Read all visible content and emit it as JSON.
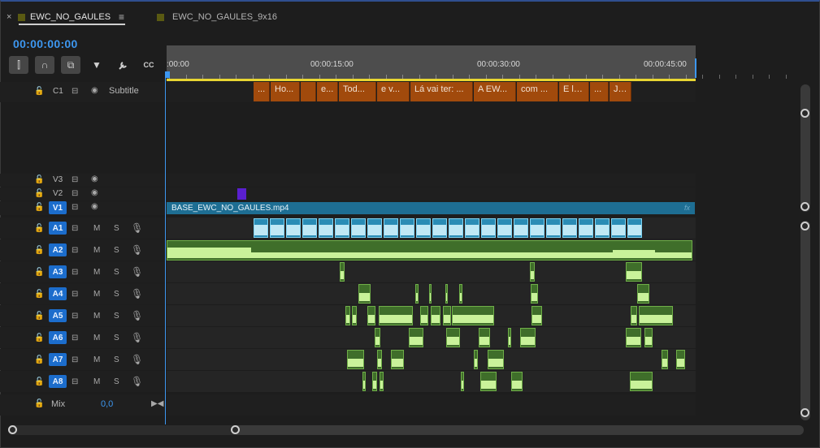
{
  "tabs": [
    {
      "label": "EWC_NO_GAULES",
      "active": true
    },
    {
      "label": "EWC_NO_GAULES_9x16",
      "active": false
    }
  ],
  "close_glyph": "×",
  "menu_glyph": "≡",
  "timecode": "00:00:00:00",
  "tools": [
    {
      "name": "insert-overwrite-icon",
      "glyph": "⫿",
      "on": true
    },
    {
      "name": "snap-magnet-icon",
      "glyph": "∩",
      "on": true
    },
    {
      "name": "linked-selection-icon",
      "glyph": "⧉",
      "on": true
    },
    {
      "name": "add-marker-icon",
      "glyph": "▼",
      "on": false
    },
    {
      "name": "wrench-icon",
      "glyph": "🔧",
      "on": false
    },
    {
      "name": "captions-icon",
      "glyph": "CC",
      "on": false
    }
  ],
  "ruler": {
    "labels": [
      ":00:00",
      "00:00:15:00",
      "00:00:30:00",
      "00:00:45:00"
    ]
  },
  "tracks": {
    "subtitle": {
      "id": "C1",
      "name": "Subtitle"
    },
    "video": [
      "V3",
      "V2",
      "V1"
    ],
    "audio": [
      "A1",
      "A2",
      "A3",
      "A4",
      "A5",
      "A6",
      "A7",
      "A8"
    ],
    "mix": {
      "label": "Mix",
      "value": "0,0"
    },
    "audio_buttons": {
      "mute": "M",
      "solo": "S"
    }
  },
  "subtitles": [
    "...",
    "Ho...",
    "",
    "e...",
    "Tod...",
    "e v...",
    "Lá vai ter: ...",
    "A EW...",
    "com ...",
    "E lá...",
    "...",
    "Já..."
  ],
  "v1_clip": {
    "label": "BASE_EWC_NO_GAULES.mp4",
    "fx": "fx"
  },
  "colors": {
    "accent_blue": "#3d97f0",
    "subtitle_clip": "#a14a0c",
    "video_clip": "#1e6e93",
    "audio_green": "#3f6e2a",
    "audio_blue": "#2a8cb5",
    "work_area": "#e7d532"
  }
}
